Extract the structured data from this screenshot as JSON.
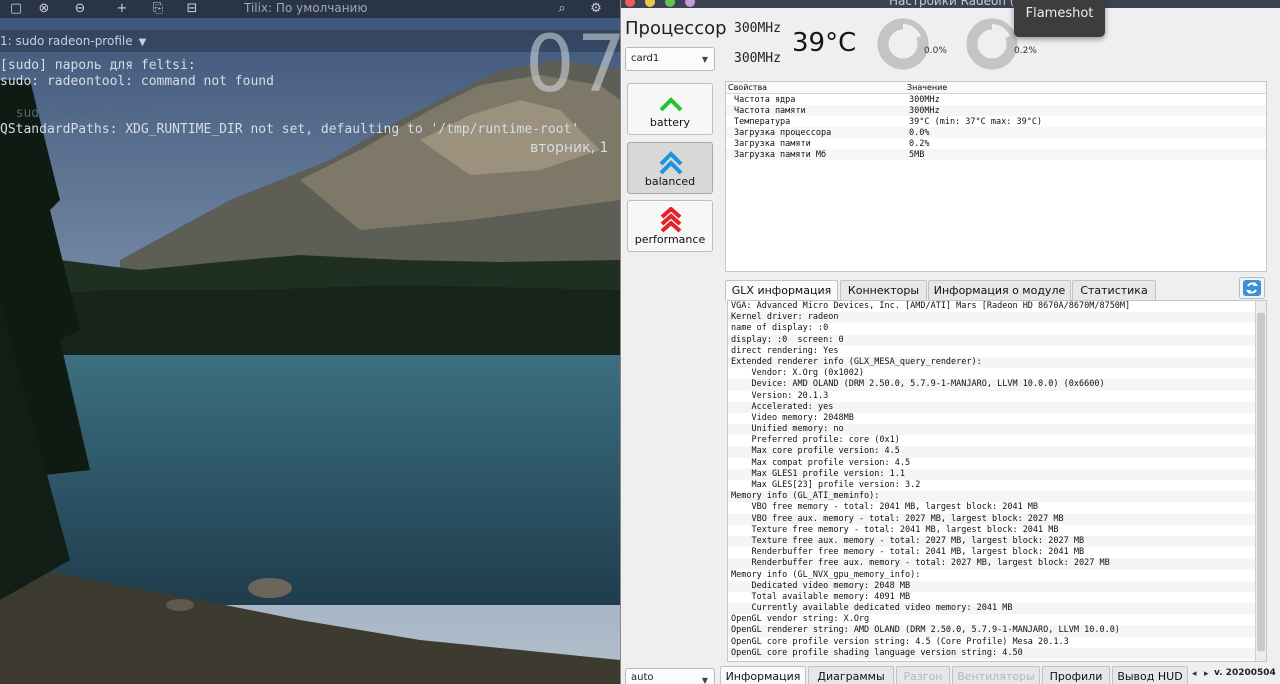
{
  "tilix": {
    "title": "Tilix: По умолчанию",
    "tab_label": "1: sudo radeon-profile",
    "lines": [
      "[sudo] пароль для feltsi:",
      "sudo: radeontool: command not found",
      "",
      "  sudo radeon-profile",
      "QStandardPaths: XDG_RUNTIME_DIR not set, defaulting to '/tmp/runtime-root'"
    ],
    "clock": "07",
    "date": "вторник, 1"
  },
  "radeon": {
    "window_title": "Настройки Radeon (ra",
    "cpu_title": "Процессор",
    "card_select": "card1",
    "auto_select": "auto",
    "core_clock": "300MHz",
    "mem_clock": "300MHz",
    "temperature": "39°C",
    "gauge1_label": "0.0%",
    "gauge2_label": "0.2%",
    "gauge1_value": 0.0,
    "gauge2_value": 0.2,
    "profiles": [
      {
        "label": "battery"
      },
      {
        "label": "balanced"
      },
      {
        "label": "performance"
      }
    ],
    "props_headers": [
      "Свойства",
      "Значение"
    ],
    "props": [
      {
        "k": "Частота ядра",
        "v": "300MHz"
      },
      {
        "k": "Частота памяти",
        "v": "300MHz"
      },
      {
        "k": "Температура",
        "v": "39°C (min: 37°C max: 39°C)"
      },
      {
        "k": "Загрузка процессора",
        "v": "0.0%"
      },
      {
        "k": "Загрузка памяти",
        "v": "0.2%"
      },
      {
        "k": "Загрузка памяти Мб",
        "v": "5MB"
      }
    ],
    "info_tabs": [
      "GLX информация",
      "Коннекторы",
      "Информация о модуле",
      "Статистика"
    ],
    "glx_lines": [
      "VGA: Advanced Micro Devices, Inc. [AMD/ATI] Mars [Radeon HD 8670A/8670M/8750M]",
      "Kernel driver: radeon",
      "name of display: :0",
      "display: :0  screen: 0",
      "direct rendering: Yes",
      "Extended renderer info (GLX_MESA_query_renderer):",
      "    Vendor: X.Org (0x1002)",
      "    Device: AMD OLAND (DRM 2.50.0, 5.7.9-1-MANJARO, LLVM 10.0.0) (0x6600)",
      "    Version: 20.1.3",
      "    Accelerated: yes",
      "    Video memory: 2048MB",
      "    Unified memory: no",
      "    Preferred profile: core (0x1)",
      "    Max core profile version: 4.5",
      "    Max compat profile version: 4.5",
      "    Max GLES1 profile version: 1.1",
      "    Max GLES[23] profile version: 3.2",
      "Memory info (GL_ATI_meminfo):",
      "    VBO free memory - total: 2041 MB, largest block: 2041 MB",
      "    VBO free aux. memory - total: 2027 MB, largest block: 2027 MB",
      "    Texture free memory - total: 2041 MB, largest block: 2041 MB",
      "    Texture free aux. memory - total: 2027 MB, largest block: 2027 MB",
      "    Renderbuffer free memory - total: 2041 MB, largest block: 2041 MB",
      "    Renderbuffer free aux. memory - total: 2027 MB, largest block: 2027 MB",
      "Memory info (GL_NVX_gpu_memory_info):",
      "    Dedicated video memory: 2048 MB",
      "    Total available memory: 4091 MB",
      "    Currently available dedicated video memory: 2041 MB",
      "OpenGL vendor string: X.Org",
      "OpenGL renderer string: AMD OLAND (DRM 2.50.0, 5.7.9-1-MANJARO, LLVM 10.0.0)",
      "OpenGL core profile version string: 4.5 (Core Profile) Mesa 20.1.3",
      "OpenGL core profile shading language version string: 4.50"
    ],
    "bottom_tabs": [
      {
        "label": "Информация",
        "active": true,
        "disabled": false
      },
      {
        "label": "Диаграммы",
        "active": false,
        "disabled": false
      },
      {
        "label": "Разгон",
        "active": false,
        "disabled": true
      },
      {
        "label": "Вентиляторы",
        "active": false,
        "disabled": true
      },
      {
        "label": "Профили",
        "active": false,
        "disabled": false
      },
      {
        "label": "Вывод HUD",
        "active": false,
        "disabled": false
      }
    ],
    "version": "v. 20200504"
  },
  "flameshot": {
    "label": "Flameshot"
  },
  "colors": {
    "up_green": "#1ec42d",
    "up_blue": "#1a93e0",
    "up_red": "#e5222a"
  }
}
